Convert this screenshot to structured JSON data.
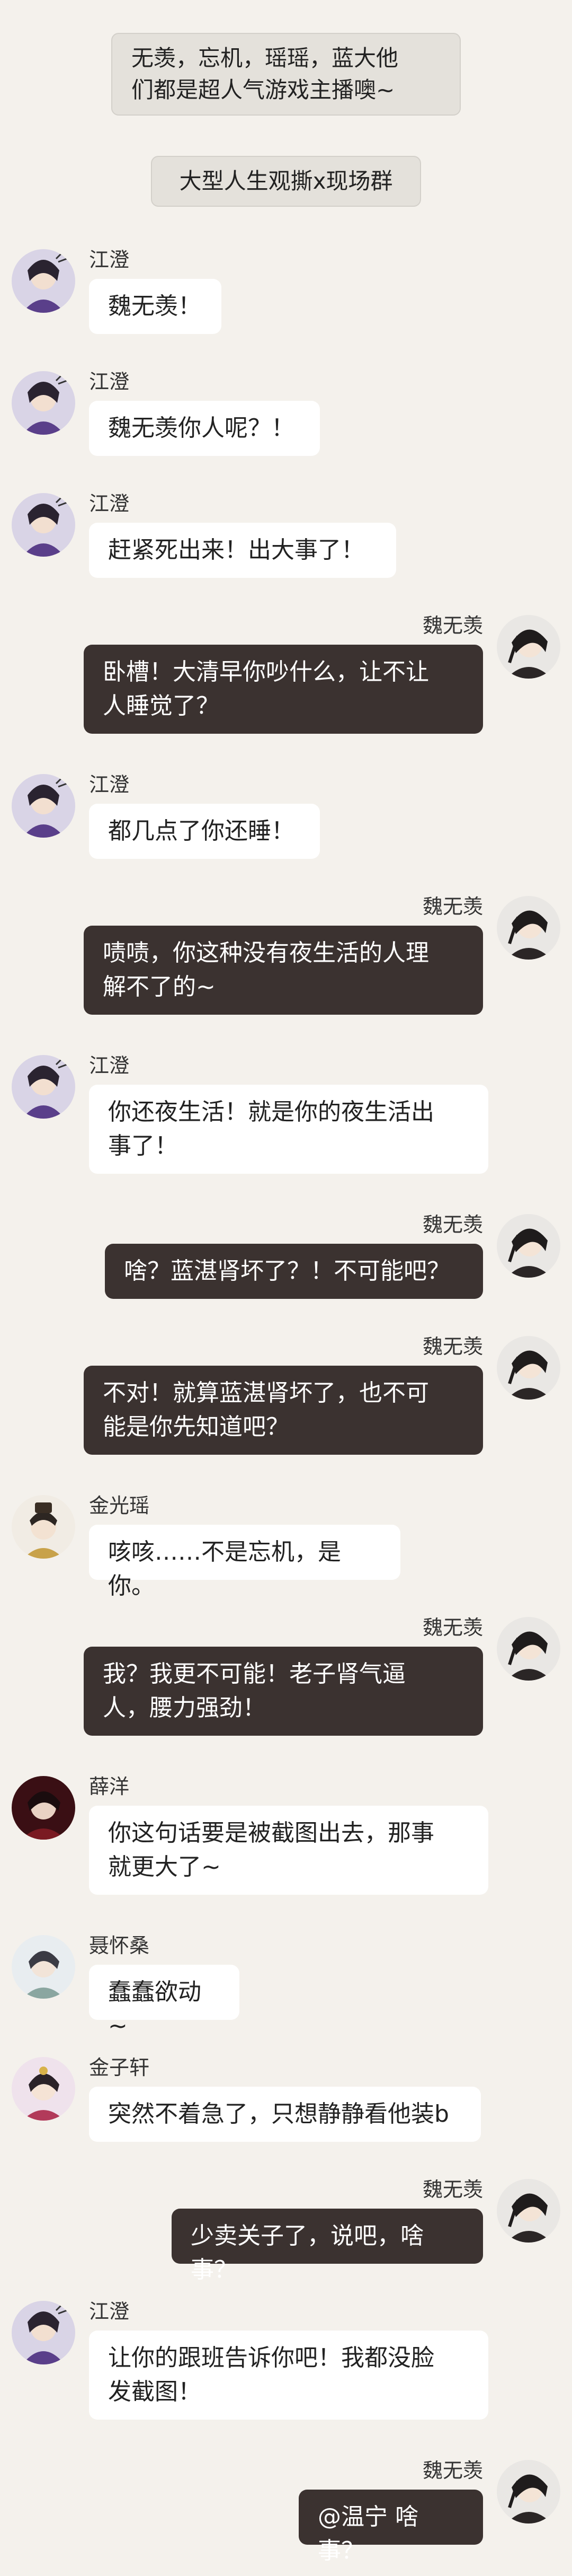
{
  "notices": [
    "无羡，忘机，瑶瑶，蓝大他\n们都是超人气游戏主播噢~",
    "大型人生观撕x现场群"
  ],
  "messages": [
    {
      "side": "left",
      "name": "江澄",
      "avatar": "jiangcheng-avatar",
      "text": "魏无羡！"
    },
    {
      "side": "left",
      "name": "江澄",
      "avatar": "jiangcheng-avatar",
      "text": "魏无羡你人呢？！"
    },
    {
      "side": "left",
      "name": "江澄",
      "avatar": "jiangcheng-avatar",
      "text": "赶紧死出来！出大事了！"
    },
    {
      "side": "right",
      "name": "魏无羡",
      "avatar": "weiwuxian-avatar",
      "text": "卧槽！大清早你吵什么，让不让\n人睡觉了？"
    },
    {
      "side": "left",
      "name": "江澄",
      "avatar": "jiangcheng-avatar",
      "text": "都几点了你还睡！"
    },
    {
      "side": "right",
      "name": "魏无羡",
      "avatar": "weiwuxian-avatar",
      "text": "啧啧，你这种没有夜生活的人理\n解不了的~"
    },
    {
      "side": "left",
      "name": "江澄",
      "avatar": "jiangcheng-avatar",
      "text": "你还夜生活！就是你的夜生活出\n事了！"
    },
    {
      "side": "right",
      "name": "魏无羡",
      "avatar": "weiwuxian-avatar",
      "text": "啥？蓝湛肾坏了？！不可能吧？"
    },
    {
      "side": "right",
      "name": "魏无羡",
      "avatar": "weiwuxian-avatar",
      "text": "不对！就算蓝湛肾坏了，也不可\n能是你先知道吧？"
    },
    {
      "side": "left",
      "name": "金光瑶",
      "avatar": "jinguangyao-avatar",
      "text": "咳咳……不是忘机，是你。"
    },
    {
      "side": "right",
      "name": "魏无羡",
      "avatar": "weiwuxian-avatar",
      "text": "我？我更不可能！老子肾气逼\n人，腰力强劲！"
    },
    {
      "side": "left",
      "name": "薛洋",
      "avatar": "xueyang-avatar",
      "text": "你这句话要是被截图出去，那事\n就更大了~"
    },
    {
      "side": "left",
      "name": "聂怀桑",
      "avatar": "niehuaisang-avatar",
      "text": "蠢蠢欲动~"
    },
    {
      "side": "left",
      "name": "金子轩",
      "avatar": "jinzixuan-avatar",
      "text": "突然不着急了，只想静静看他装b"
    },
    {
      "side": "right",
      "name": "魏无羡",
      "avatar": "weiwuxian-avatar",
      "text": "少卖关子了，说吧，啥事？"
    },
    {
      "side": "left",
      "name": "江澄",
      "avatar": "jiangcheng-avatar",
      "text": "让你的跟班告诉你吧！我都没脸\n发截图！"
    },
    {
      "side": "right",
      "name": "魏无羡",
      "avatar": "weiwuxian-avatar",
      "text": "@温宁 啥事？"
    }
  ]
}
